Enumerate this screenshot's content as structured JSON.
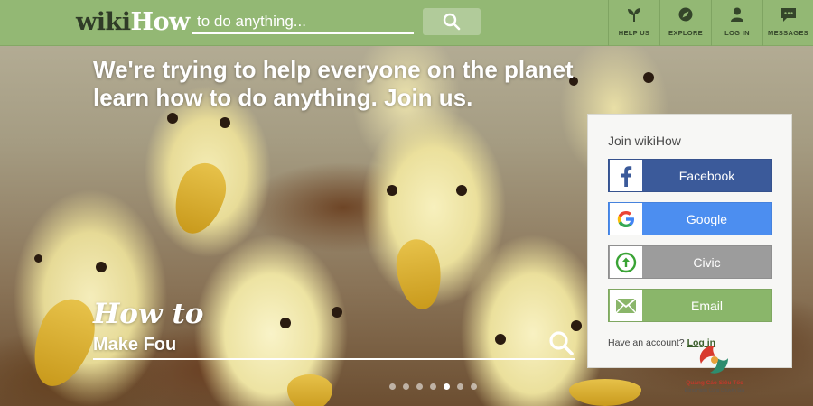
{
  "header": {
    "logo_wiki": "wiki",
    "logo_how": "How",
    "search_placeholder": "to do anything...",
    "nav": [
      {
        "label": "HELP US",
        "icon": "sprout-icon"
      },
      {
        "label": "EXPLORE",
        "icon": "compass-icon"
      },
      {
        "label": "LOG IN",
        "icon": "user-icon"
      },
      {
        "label": "MESSAGES",
        "icon": "chat-icon"
      }
    ]
  },
  "hero": {
    "headline_line1": "We're trying to help everyone on the planet",
    "headline_line2": "learn how to do anything. Join us.",
    "howto_label": "How to",
    "howto_value": "Make Fou",
    "carousel": {
      "count": 7,
      "active_index": 4
    }
  },
  "join": {
    "title": "Join wikiHow",
    "buttons": [
      {
        "label": "Facebook",
        "icon": "facebook-icon",
        "color": "#3b5a9a"
      },
      {
        "label": "Google",
        "icon": "google-icon",
        "color": "#4c8ef0"
      },
      {
        "label": "Civic",
        "icon": "civic-icon",
        "color": "#9c9c9c"
      },
      {
        "label": "Email",
        "icon": "email-icon",
        "color": "#8ab66a"
      }
    ],
    "account_text": "Have an account?",
    "login_link": "Log in"
  },
  "watermark": {
    "text": "Quảng Cáo Siêu Tốc",
    "subtext": "Đồng Hành Cùng Chuyên Gia"
  },
  "colors": {
    "header_green": "#93b874",
    "accent_green": "#8ab66a"
  }
}
